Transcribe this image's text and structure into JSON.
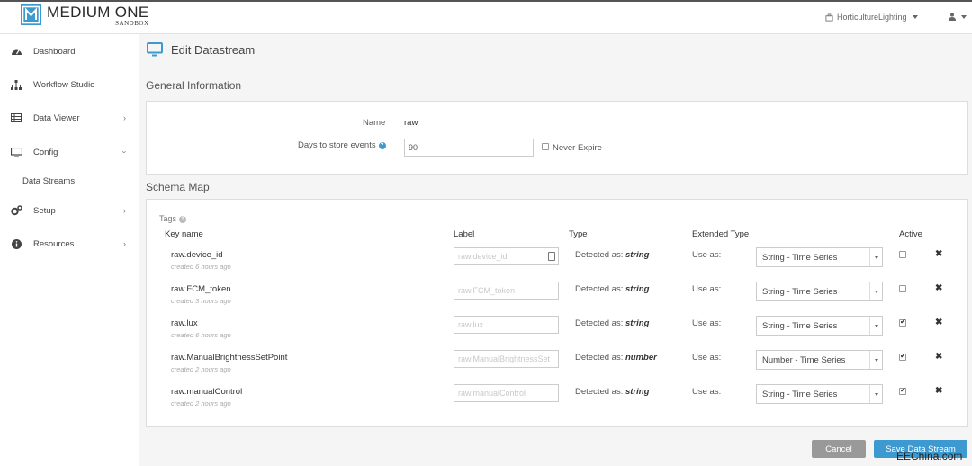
{
  "header": {
    "logo_title": "MEDIUM ONE",
    "logo_subtitle": "SANDBOX",
    "project": "HorticultureLighting"
  },
  "sidebar": {
    "items": [
      {
        "label": "Dashboard",
        "icon": "dashboard-icon"
      },
      {
        "label": "Workflow Studio",
        "icon": "sitemap-icon"
      },
      {
        "label": "Data Viewer",
        "icon": "table-icon"
      },
      {
        "label": "Config",
        "icon": "monitor-icon"
      },
      {
        "label": "Setup",
        "icon": "gears-icon"
      },
      {
        "label": "Resources",
        "icon": "info-icon"
      }
    ],
    "sub_items": [
      {
        "label": "Data Streams"
      }
    ]
  },
  "page": {
    "title": "Edit Datastream",
    "general_title": "General Information",
    "schema_title": "Schema Map"
  },
  "general": {
    "name_label": "Name",
    "name_value": "raw",
    "days_label": "Days to store events",
    "days_value": "90",
    "never_expire_label": "Never Expire"
  },
  "schema": {
    "tags_label": "Tags",
    "columns": {
      "key": "Key name",
      "label": "Label",
      "type": "Type",
      "extended": "Extended Type",
      "active": "Active"
    },
    "detected_prefix": "Detected as:",
    "use_as_label": "Use as:",
    "rows": [
      {
        "key": "raw.device_id",
        "created": "created 6 hours ago",
        "label_placeholder": "raw.device_id",
        "type": "string",
        "ext": "String - Time Series",
        "active": false
      },
      {
        "key": "raw.FCM_token",
        "created": "created 3 hours ago",
        "label_placeholder": "raw.FCM_token",
        "type": "string",
        "ext": "String - Time Series",
        "active": false
      },
      {
        "key": "raw.lux",
        "created": "created 6 hours ago",
        "label_placeholder": "raw.lux",
        "type": "string",
        "ext": "String - Time Series",
        "active": true
      },
      {
        "key": "raw.ManualBrightnessSetPoint",
        "created": "created 2 hours ago",
        "label_placeholder": "raw.ManualBrightnessSet",
        "type": "number",
        "ext": "Number - Time Series",
        "active": true
      },
      {
        "key": "raw.manualControl",
        "created": "created 2 hours ago",
        "label_placeholder": "raw.manualControl",
        "type": "string",
        "ext": "String - Time Series",
        "active": true
      }
    ]
  },
  "actions": {
    "cancel": "Cancel",
    "save": "Save Data Stream"
  },
  "watermark": "EEChina.com",
  "colors": {
    "accent": "#3d9ad1",
    "cancel": "#999999",
    "background": "#f5f5f5"
  }
}
